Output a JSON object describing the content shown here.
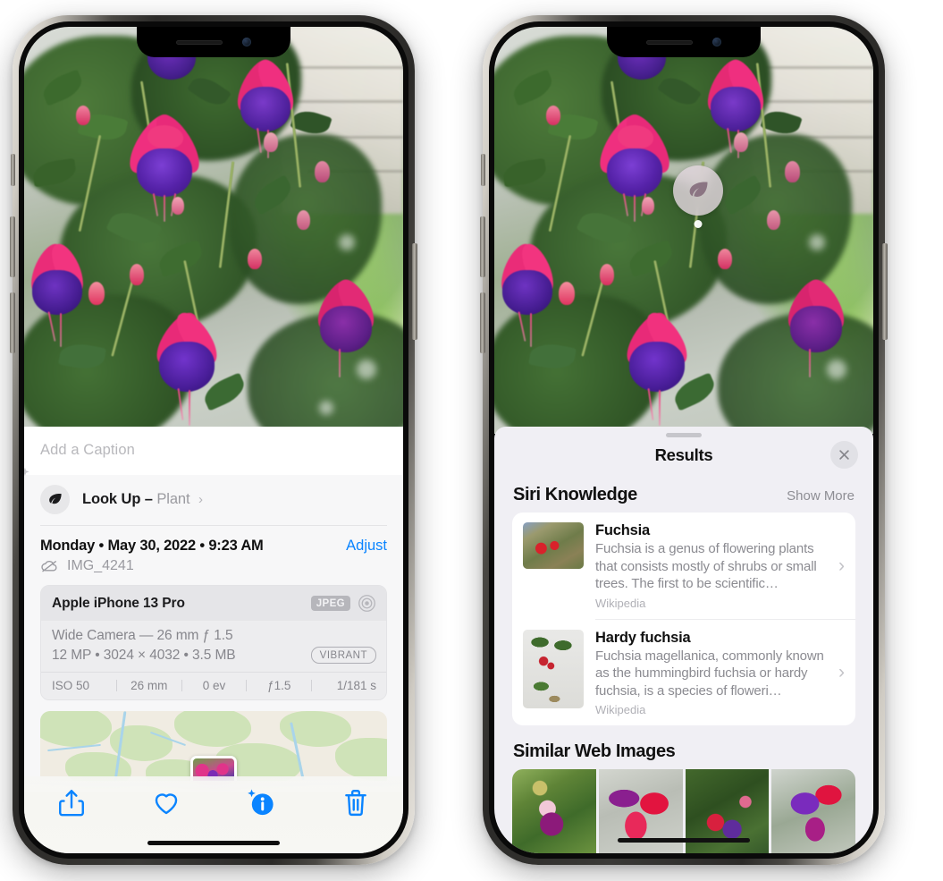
{
  "left_phone": {
    "name": "photos-detail-screen",
    "caption_field": {
      "placeholder": "Add a Caption",
      "value": ""
    },
    "lookup": {
      "icon": "leaf-icon",
      "sparkle_icon": "sparkles-icon",
      "label": "Look Up –",
      "subject": "Plant",
      "chevron": "›"
    },
    "date_row": {
      "date": "Monday • May 30, 2022 • 9:23 AM",
      "adjust_label": "Adjust"
    },
    "file_row": {
      "icon": "cloud-slash-icon",
      "filename": "IMG_4241"
    },
    "exif": {
      "model": "Apple iPhone 13 Pro",
      "format_badge": "JPEG",
      "lens_icon": "aperture-icon",
      "lens_line": "Wide Camera — 26 mm ƒ 1.5",
      "specs_line": "12 MP • 3024 × 4032 • 3.5 MB",
      "style_badge": "VIBRANT",
      "stats": [
        "ISO 50",
        "26 mm",
        "0 ev",
        "ƒ1.5",
        "1/181 s"
      ]
    },
    "map": {
      "name": "location-map",
      "pin": "photo-pin"
    },
    "toolbar": [
      {
        "name": "share-button",
        "icon": "share-icon"
      },
      {
        "name": "favorite-button",
        "icon": "heart-icon"
      },
      {
        "name": "info-button",
        "icon": "info-sparkle-icon"
      },
      {
        "name": "delete-button",
        "icon": "trash-icon"
      }
    ]
  },
  "right_phone": {
    "name": "visual-lookup-results-screen",
    "photo_badge": {
      "icon": "leaf-icon",
      "name": "visual-lookup-badge"
    },
    "sheet": {
      "title": "Results",
      "close_icon": "close-icon",
      "sections": [
        {
          "title": "Siri Knowledge",
          "action_label": "Show More",
          "items": [
            {
              "title": "Fuchsia",
              "description": "Fuchsia is a genus of flowering plants that consists mostly of shrubs or small trees. The first to be scientific…",
              "source": "Wikipedia",
              "chevron": "›"
            },
            {
              "title": "Hardy fuchsia",
              "description": "Fuchsia magellanica, commonly known as the hummingbird fuchsia or hardy fuchsia, is a species of floweri…",
              "source": "Wikipedia",
              "chevron": "›"
            }
          ]
        },
        {
          "title": "Similar Web Images",
          "thumbnails": [
            "web-image-1",
            "web-image-2",
            "web-image-3",
            "web-image-4"
          ]
        }
      ]
    }
  },
  "colors": {
    "accent_blue": "#0a84ff",
    "sheet_bg": "#f0eff4",
    "panel_bg": "#f7f7f8",
    "card_bg": "#ffffff",
    "secondary_text": "#8b8b91"
  }
}
